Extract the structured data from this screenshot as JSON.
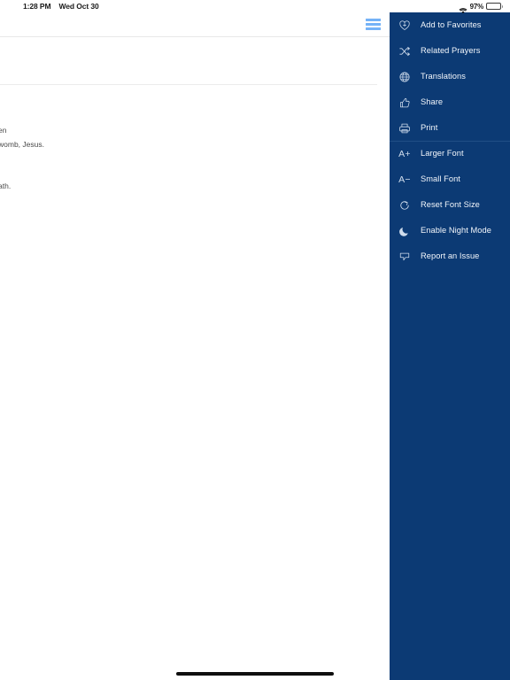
{
  "status_bar": {
    "time": "1:28 PM",
    "date": "Wed Oct 30",
    "battery_percent": "97%",
    "wifi_icon": "wifi-icon",
    "battery_icon": "battery-icon"
  },
  "toolbar": {
    "menu_icon": "hamburger-menu-icon"
  },
  "document": {
    "lines": [
      "en",
      "womb, Jesus.",
      "ath."
    ]
  },
  "menu": {
    "background_color": "#0c3a74",
    "text_color": "#f2f6fb",
    "divider_color": "#204e86",
    "items": [
      {
        "label": "Add to Favorites",
        "icon": "heart-plus-icon",
        "divider_above": false
      },
      {
        "label": "Related Prayers",
        "icon": "shuffle-icon",
        "divider_above": false
      },
      {
        "label": "Translations",
        "icon": "globe-icon",
        "divider_above": false
      },
      {
        "label": "Share",
        "icon": "thumbs-up-icon",
        "divider_above": false
      },
      {
        "label": "Print",
        "icon": "printer-icon",
        "divider_above": false
      },
      {
        "label": "Larger Font",
        "icon": "a-plus-icon",
        "glyph": "A+",
        "divider_above": true
      },
      {
        "label": "Small Font",
        "icon": "a-minus-icon",
        "glyph": "A−",
        "divider_above": false
      },
      {
        "label": "Reset Font Size",
        "icon": "refresh-circle-icon",
        "divider_above": false
      },
      {
        "label": "Enable Night Mode",
        "icon": "moon-icon",
        "divider_above": false
      },
      {
        "label": "Report an Issue",
        "icon": "speech-bubble-icon",
        "divider_above": false
      }
    ]
  },
  "home_indicator": {
    "color": "#0f0f0f"
  }
}
